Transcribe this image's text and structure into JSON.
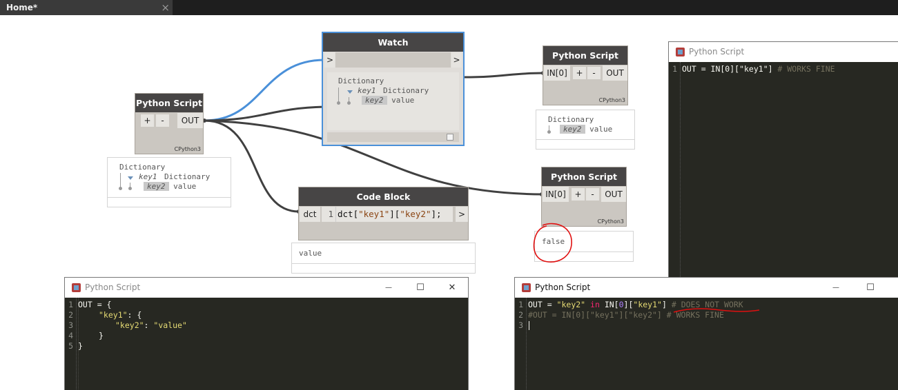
{
  "tab": {
    "title": "Home*",
    "close": "×"
  },
  "watch": {
    "title": "Watch",
    "in_port": ">",
    "out_port": ">",
    "preview": {
      "type": "Dictionary",
      "key1": "key1",
      "key1_type": "Dictionary",
      "key2": "key2",
      "key2_value": "value"
    }
  },
  "ps_source": {
    "title": "Python Script",
    "add": "+",
    "remove": "-",
    "out": "OUT",
    "engine": "CPython3",
    "preview": {
      "type": "Dictionary",
      "key1": "key1",
      "key1_type": "Dictionary",
      "key2": "key2",
      "key2_value": "value"
    }
  },
  "ps_top": {
    "title": "Python Script",
    "in": "IN[0]",
    "add": "+",
    "remove": "-",
    "out": "OUT",
    "engine": "CPython3",
    "preview": {
      "type": "Dictionary",
      "key2": "key2",
      "key2_value": "value"
    }
  },
  "ps_mid": {
    "title": "Python Script",
    "in": "IN[0]",
    "add": "+",
    "remove": "-",
    "out": "OUT",
    "engine": "CPython3",
    "preview": {
      "value": "false"
    }
  },
  "code_block": {
    "title": "Code Block",
    "in": "dct",
    "line_no": "1",
    "code_prefix": "dct[",
    "str1": "\"key1\"",
    "mid": "][",
    "str2": "\"key2\"",
    "code_suffix": "];",
    "out": ">",
    "preview": {
      "value": "value"
    }
  },
  "editor_top": {
    "title": "Python Script",
    "lines": [
      {
        "no": "1",
        "code": "OUT = IN[0][\"key1\"]",
        "comment": "# WORKS FINE"
      }
    ]
  },
  "editor_left": {
    "title": "Python Script",
    "minimize": "—",
    "maximize": "☐",
    "close": "✕",
    "line_nos": [
      "1",
      "2",
      "3",
      "4",
      "5"
    ],
    "l1": "OUT = {",
    "l2_key": "\"key1\"",
    "l2_rest": ": {",
    "l3_key": "\"key2\"",
    "l3_sep": ": ",
    "l3_val": "\"value\"",
    "l4": "}",
    "l5": "}"
  },
  "editor_right": {
    "title": "Python Script",
    "minimize": "—",
    "maximize": "☐",
    "line_nos": [
      "1",
      "2",
      "3"
    ],
    "l1_a": "OUT = ",
    "l1_str": "\"key2\"",
    "l1_kw": "in",
    "l1_b": "IN[",
    "l1_num": "0",
    "l1_c": "][",
    "l1_str2": "\"key1\"",
    "l1_d": "]",
    "l1_cmt_a": "# ",
    "l1_cmt_b": "DOES NOT WORK",
    "l2": "#OUT = IN[0][\"key1\"][\"key2\"] # WORKS FINE"
  },
  "colors": {
    "wire": "#404040",
    "wire_selected": "#4a90d9",
    "annotation": "#e01010",
    "editor_bg": "#272822"
  }
}
